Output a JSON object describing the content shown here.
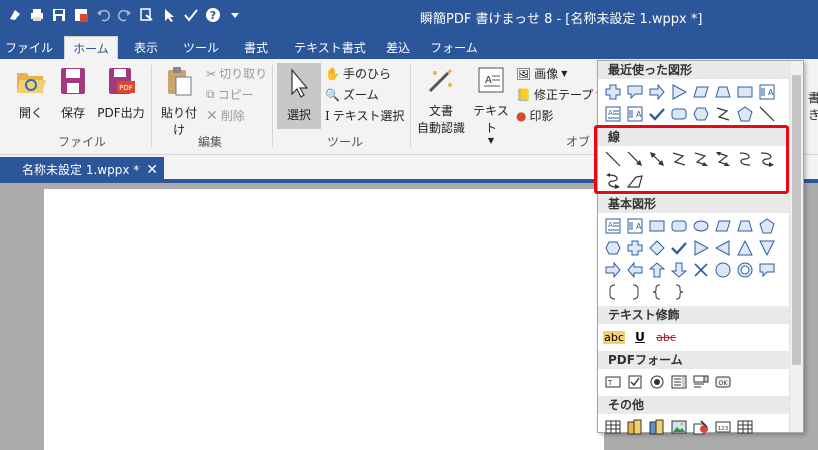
{
  "window": {
    "title": "瞬簡PDF 書けまっせ 8 - [名称未設定 1.wppx *]"
  },
  "tabs": [
    "ファイル",
    "ホーム",
    "表示",
    "ツール",
    "書式",
    "テキスト書式",
    "差込",
    "フォーム"
  ],
  "ribbon": {
    "file_group": {
      "open": "開く",
      "save": "保存",
      "pdf_out": "PDF出力",
      "label": "ファイル"
    },
    "edit_group": {
      "paste": "貼り付け",
      "cut": "切り取り",
      "copy": "コピー",
      "delete": "削除",
      "label": "編集"
    },
    "tool_group": {
      "select": "選択",
      "hand": "手のひら",
      "zoom": "ズーム",
      "text_select": "テキスト選択",
      "label": "ツール"
    },
    "insert_group": {
      "doc_auto": "文書",
      "doc_auto2": "自動認識",
      "text": "テキスト",
      "image": "画像",
      "correction_tape": "修正テープ",
      "stamp": "印影",
      "label": "オブ"
    },
    "right_cut": "書き"
  },
  "doc_tab": {
    "name": "名称未設定 1.wppx *"
  },
  "shapes_menu": {
    "sections": [
      {
        "title": "最近使った図形",
        "icons": [
          "cross-shape",
          "callout-shape",
          "arrow-right-shape",
          "triangle-right-shape",
          "parallelogram-shape",
          "trapezoid-shape",
          "rectangle-shape",
          "vertical-text-box",
          "text-box",
          "vertical-text-box",
          "check-shape",
          "rounded-rectangle-shape",
          "hexagon-shape",
          "zigzag-line",
          "pentagon-shape",
          "line-shape"
        ]
      },
      {
        "title": "線",
        "icons": [
          "line",
          "arrow-line",
          "double-arrow-line",
          "zigzag-line",
          "zigzag-arrow-line",
          "zigzag-double-arrow-line",
          "curve-line",
          "curve-arrow-line",
          "curve-double-arrow-line",
          "freeform-line"
        ]
      },
      {
        "title": "基本図形",
        "icons": [
          "text-box",
          "vertical-text-box",
          "rectangle",
          "rounded-rectangle",
          "ellipse",
          "parallelogram",
          "trapezoid",
          "pentagon",
          "hexagon",
          "cross",
          "diamond",
          "check",
          "triangle-right",
          "triangle-left",
          "triangle-up",
          "triangle-down",
          "arrow-right",
          "arrow-left",
          "arrow-up",
          "arrow-down",
          "x-mark",
          "circle",
          "donut",
          "callout",
          "bracket-left",
          "bracket-right",
          "brace-left",
          "brace-right"
        ]
      },
      {
        "title": "テキスト修飾",
        "icons": [
          "highlight-text",
          "underline-text",
          "strikethrough-text"
        ]
      },
      {
        "title": "PDFフォーム",
        "icons": [
          "text-field",
          "checkbox",
          "radio-button",
          "list-box",
          "combo-box",
          "push-button"
        ]
      },
      {
        "title": "その他",
        "icons": [
          "table",
          "books",
          "books-2",
          "image",
          "stamp",
          "number-field",
          "table-2"
        ]
      }
    ],
    "text_decoration_labels": [
      "abc",
      "U",
      "abc"
    ],
    "form_labels": [
      "T",
      "OK"
    ],
    "number_label": "123"
  },
  "colors": {
    "accent": "#2b579a",
    "highlight": "#e30c14",
    "icon_blue": "#2f5f9e"
  }
}
